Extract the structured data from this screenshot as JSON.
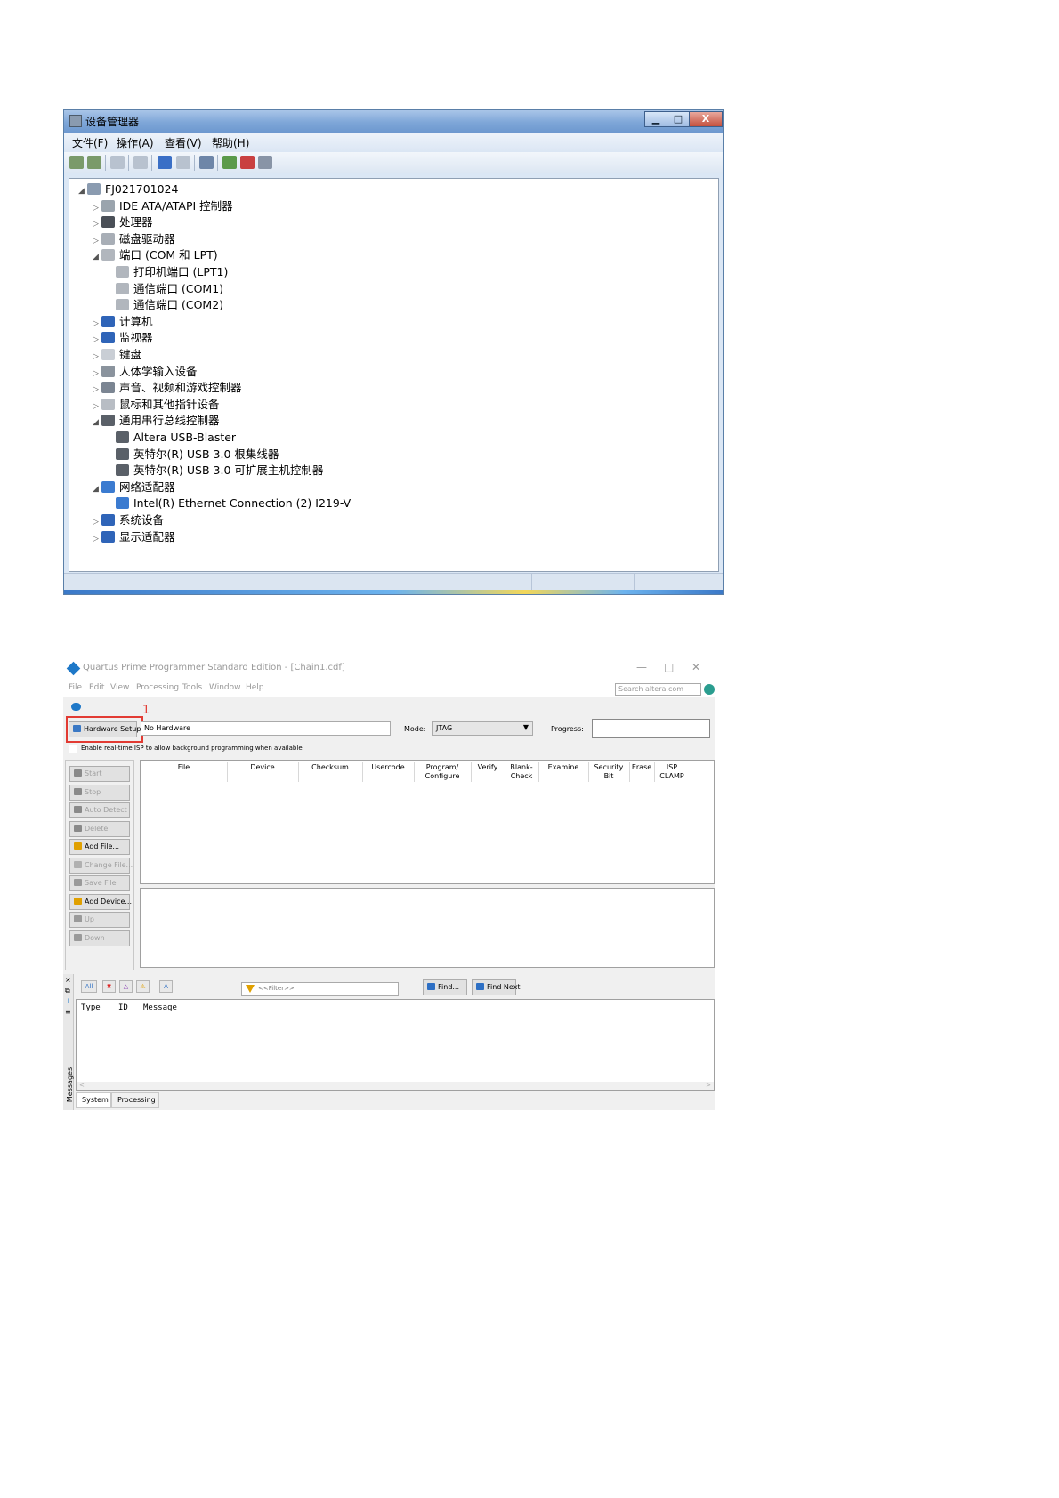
{
  "device_manager": {
    "title": "设备管理器",
    "window_buttons": {
      "minimize": "▁",
      "maximize": "□",
      "close": "X"
    },
    "menu": [
      "文件(F)",
      "操作(A)",
      "查看(V)",
      "帮助(H)"
    ],
    "tree": [
      {
        "label": "FJ021701024",
        "level": 0,
        "expander": "◢",
        "icon": "computer-root-icon"
      },
      {
        "label": "IDE ATA/ATAPI 控制器",
        "level": 1,
        "expander": "▷",
        "icon": "ide-controller-icon"
      },
      {
        "label": "处理器",
        "level": 1,
        "expander": "▷",
        "icon": "processor-icon"
      },
      {
        "label": "磁盘驱动器",
        "level": 1,
        "expander": "▷",
        "icon": "disk-drive-icon"
      },
      {
        "label": "端口 (COM 和 LPT)",
        "level": 1,
        "expander": "◢",
        "icon": "port-icon"
      },
      {
        "label": "打印机端口 (LPT1)",
        "level": 2,
        "expander": "",
        "icon": "port-icon"
      },
      {
        "label": "通信端口 (COM1)",
        "level": 2,
        "expander": "",
        "icon": "port-icon"
      },
      {
        "label": "通信端口 (COM2)",
        "level": 2,
        "expander": "",
        "icon": "port-icon"
      },
      {
        "label": "计算机",
        "level": 1,
        "expander": "▷",
        "icon": "computer-icon"
      },
      {
        "label": "监视器",
        "level": 1,
        "expander": "▷",
        "icon": "monitor-icon"
      },
      {
        "label": "键盘",
        "level": 1,
        "expander": "▷",
        "icon": "keyboard-icon"
      },
      {
        "label": "人体学输入设备",
        "level": 1,
        "expander": "▷",
        "icon": "hid-icon"
      },
      {
        "label": "声音、视频和游戏控制器",
        "level": 1,
        "expander": "▷",
        "icon": "sound-icon"
      },
      {
        "label": "鼠标和其他指针设备",
        "level": 1,
        "expander": "▷",
        "icon": "mouse-icon"
      },
      {
        "label": "通用串行总线控制器",
        "level": 1,
        "expander": "◢",
        "icon": "usb-icon"
      },
      {
        "label": "Altera USB-Blaster",
        "level": 2,
        "expander": "",
        "icon": "usb-icon"
      },
      {
        "label": "英特尔(R) USB 3.0 根集线器",
        "level": 2,
        "expander": "",
        "icon": "usb-icon"
      },
      {
        "label": "英特尔(R) USB 3.0 可扩展主机控制器",
        "level": 2,
        "expander": "",
        "icon": "usb-icon"
      },
      {
        "label": "网络适配器",
        "level": 1,
        "expander": "◢",
        "icon": "network-icon"
      },
      {
        "label": "Intel(R) Ethernet Connection (2) I219-V",
        "level": 2,
        "expander": "",
        "icon": "network-icon"
      },
      {
        "label": "系统设备",
        "level": 1,
        "expander": "▷",
        "icon": "system-device-icon"
      },
      {
        "label": "显示适配器",
        "level": 1,
        "expander": "▷",
        "icon": "display-adapter-icon"
      }
    ]
  },
  "quartus": {
    "title": "Quartus Prime Programmer Standard Edition - [Chain1.cdf]",
    "window_buttons": {
      "minimize": "—",
      "maximize": "□",
      "close": "✕"
    },
    "menu": [
      "File",
      "Edit",
      "View",
      "Processing",
      "Tools",
      "Window",
      "Help"
    ],
    "search_placeholder": "Search altera.com",
    "annotation_number": "1",
    "hardware_setup_label": "Hardware Setup...",
    "hardware_value": "No Hardware",
    "mode_label": "Mode:",
    "mode_value": "JTAG",
    "progress_label": "Progress:",
    "isp_checkbox_label": "Enable real-time ISP to allow background programming when available",
    "side_buttons": [
      {
        "label": "Start",
        "enabled": false
      },
      {
        "label": "Stop",
        "enabled": false
      },
      {
        "label": "Auto Detect",
        "enabled": false
      },
      {
        "label": "Delete",
        "enabled": false
      },
      {
        "label": "Add File...",
        "enabled": true
      },
      {
        "label": "Change File...",
        "enabled": false
      },
      {
        "label": "Save File",
        "enabled": false
      },
      {
        "label": "Add Device...",
        "enabled": true
      },
      {
        "label": "Up",
        "enabled": false
      },
      {
        "label": "Down",
        "enabled": false
      }
    ],
    "columns": [
      "File",
      "Device",
      "Checksum",
      "Usercode",
      "Program/ Configure",
      "Verify",
      "Blank- Check",
      "Examine",
      "Security Bit",
      "Erase",
      "ISP CLAMP"
    ],
    "messages": {
      "filter_buttons": [
        "All"
      ],
      "filter_placeholder": "<<Filter>>",
      "find_label": "Find...",
      "find_next_label": "Find Next",
      "columns": [
        "Type",
        "ID",
        "Message"
      ],
      "side_label": "Messages",
      "tabs": [
        "System",
        "Processing"
      ]
    }
  }
}
